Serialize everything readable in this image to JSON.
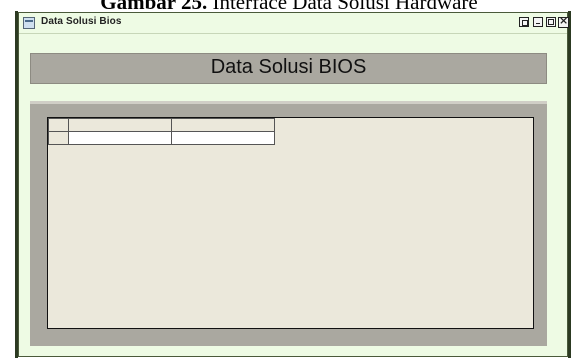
{
  "caption": {
    "bold": "Gambar 25.",
    "text": " Interface Data Solusi Hardware"
  },
  "window": {
    "title": "Data Solusi Bios",
    "icon": "window-icon",
    "buttons": [
      "restore-icon",
      "minimize-icon",
      "maximize-icon",
      "close-icon"
    ]
  },
  "header": {
    "title": "Data Solusi BIOS"
  },
  "grid": {
    "columns": [
      "",
      ""
    ],
    "rows": [
      {
        "row_header": "",
        "cells": [
          "",
          ""
        ]
      }
    ]
  }
}
